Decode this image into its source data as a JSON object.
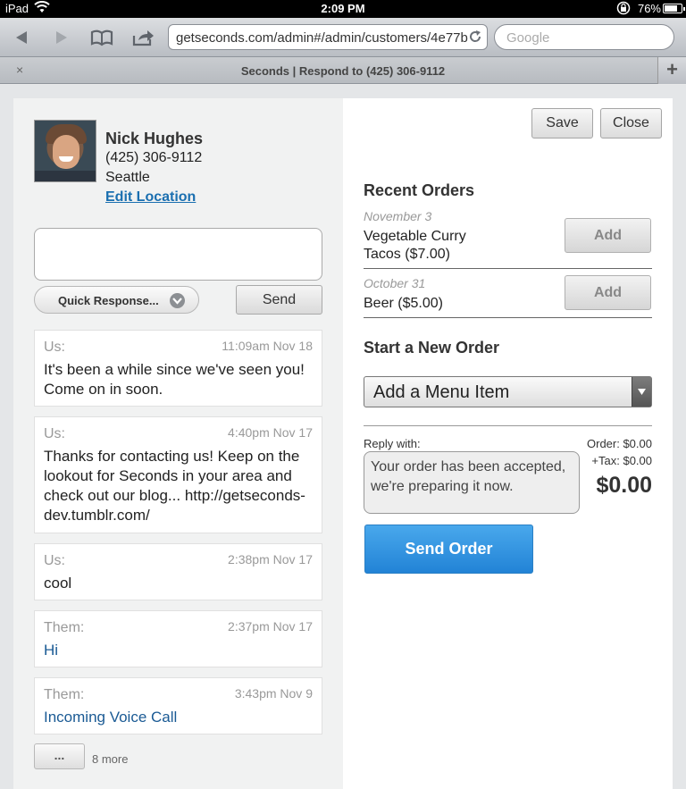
{
  "status_bar": {
    "device": "iPad",
    "time": "2:09 PM",
    "battery": "76%",
    "battery_level": 0.76
  },
  "browser": {
    "url": "getseconds.com/admin#/admin/customers/4e77b",
    "search_placeholder": "Google",
    "tab_title": "Seconds | Respond to (425) 306-9112",
    "tab_close": "×",
    "new_tab": "+",
    "icons": [
      "back-icon",
      "forward-icon",
      "bookmarks-icon",
      "share-icon",
      "reload-icon"
    ]
  },
  "customer": {
    "name": "Nick Hughes",
    "phone": "(425) 306-9112",
    "city": "Seattle",
    "edit_location": "Edit Location"
  },
  "compose": {
    "message_value": "",
    "quick_response": "Quick Response...",
    "send": "Send"
  },
  "messages": [
    {
      "sender": "Us:",
      "time": "11:09am Nov 18",
      "text": "It's been a while since we've seen you! Come on in soon."
    },
    {
      "sender": "Us:",
      "time": "4:40pm Nov 17",
      "text": "Thanks for contacting us! Keep on the lookout for Seconds in your area and check out our blog... http://getseconds-dev.tumblr.com/"
    },
    {
      "sender": "Us:",
      "time": "2:38pm Nov 17",
      "text": "cool"
    },
    {
      "sender": "Them:",
      "time": "2:37pm Nov 17",
      "text": "Hi"
    },
    {
      "sender": "Them:",
      "time": "3:43pm Nov 9",
      "text": "Incoming Voice Call"
    }
  ],
  "more": {
    "button": "...",
    "count": "8 more"
  },
  "actions": {
    "save": "Save",
    "close": "Close"
  },
  "recent_orders": {
    "title": "Recent Orders",
    "orders": [
      {
        "date": "November 3",
        "item": "Vegetable Curry Tacos ($7.00)",
        "add": "Add"
      },
      {
        "date": "October 31",
        "item": "Beer ($5.00)",
        "add": "Add"
      }
    ]
  },
  "new_order": {
    "title": "Start a New Order",
    "menu_select": "Add a Menu Item",
    "reply_label": "Reply with:",
    "reply_text": "Your order has been accepted, we're preparing it now.",
    "order_total": "Order: $0.00",
    "tax": "+Tax: $0.00",
    "grand_total": "$0.00",
    "send_order": "Send Order"
  },
  "colors": {
    "link": "#1a6fb0",
    "them_text": "#1a5a94",
    "send_order": "#2283d6"
  }
}
